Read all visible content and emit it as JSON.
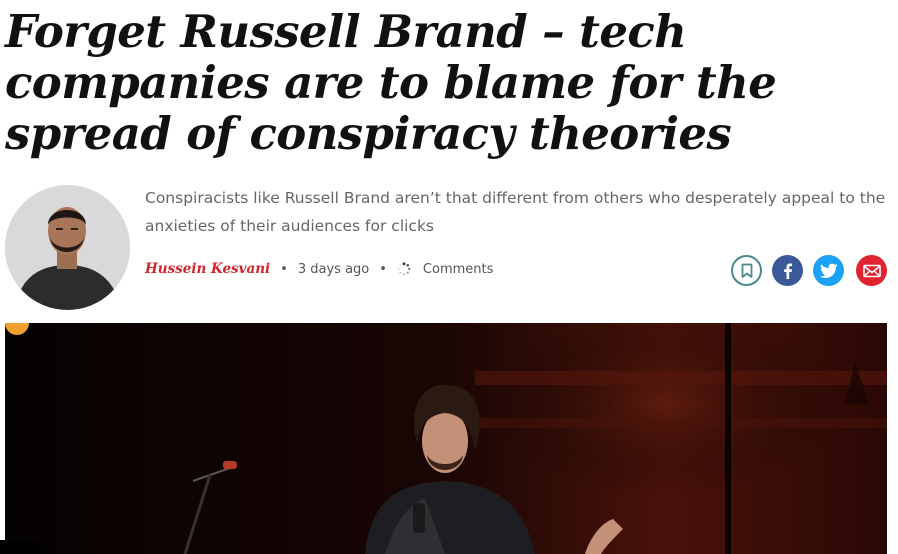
{
  "article": {
    "headline": "Forget Russell Brand – tech companies are to blame for the spread of conspiracy theories",
    "standfirst": "Conspiracists like Russell Brand aren’t that different from others who desperately appeal to the anxieties of their audiences for clicks",
    "author": "Hussein Kesvani",
    "published": "3 days ago",
    "comments_label": "Comments"
  },
  "share": {
    "bookmark_icon": "bookmark-icon",
    "facebook_icon": "facebook-icon",
    "twitter_icon": "twitter-icon",
    "email_icon": "email-icon"
  },
  "colors": {
    "author_red": "#d4232b",
    "bookmark_teal": "#4a8a8f",
    "facebook_blue": "#3b5998",
    "twitter_blue": "#1da1f2",
    "email_red": "#e0242f"
  }
}
